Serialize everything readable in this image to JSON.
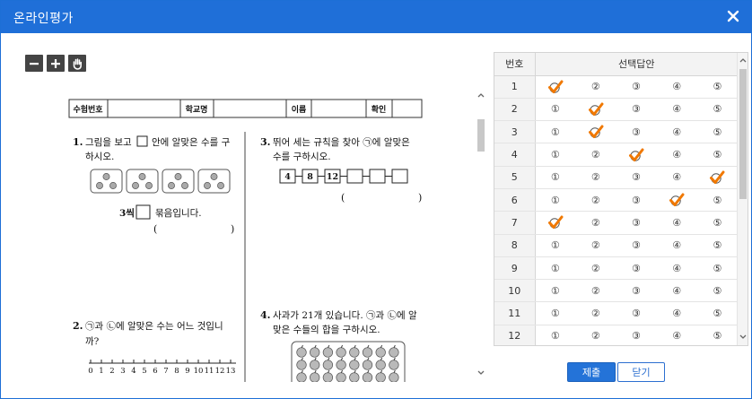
{
  "window": {
    "title": "온라인평가"
  },
  "toolbar": {
    "zoom_out": "minus-icon",
    "zoom_in": "plus-icon",
    "pan": "hand-icon"
  },
  "exam_header": {
    "exam_no_label": "수험번호",
    "school_label": "학교명",
    "name_label": "이름",
    "confirm_label": "확인"
  },
  "questions": {
    "q1": {
      "num": "1.",
      "line1": "그림을 보고",
      "line1b": "안에 알맞은 수를 구",
      "line2": "하시오.",
      "answer_a": "3씩",
      "answer_b": "묶음입니다.",
      "paren_open": "(",
      "paren_close": ")"
    },
    "q2": {
      "num": "2.",
      "line1": "㉠과 ㉡에 알맞은 수는 어느 것입니",
      "line2": "까?",
      "ticks": [
        "0",
        "1",
        "2",
        "3",
        "4",
        "5",
        "6",
        "7",
        "8",
        "9",
        "10",
        "11",
        "12",
        "13"
      ]
    },
    "q3": {
      "num": "3.",
      "line1": "뛰어 세는 규칙을 찾아 ㉠에 알맞은",
      "line2": "수를 구하시오.",
      "boxes": [
        "4",
        "8",
        "12",
        "",
        "",
        ""
      ],
      "paren_open": "(",
      "paren_close": ")"
    },
    "q4": {
      "num": "4.",
      "line1": "사과가 21개 있습니다. ㉠과 ㉡에 알",
      "line2": "맞은 수들의 합을 구하시오."
    }
  },
  "answer_sheet": {
    "col_number": "번호",
    "col_answer": "선택답안",
    "options": [
      "①",
      "②",
      "③",
      "④",
      "⑤"
    ],
    "rows": [
      {
        "no": "1",
        "selected": 1
      },
      {
        "no": "2",
        "selected": 2
      },
      {
        "no": "3",
        "selected": 2
      },
      {
        "no": "4",
        "selected": 3
      },
      {
        "no": "5",
        "selected": 5
      },
      {
        "no": "6",
        "selected": 4
      },
      {
        "no": "7",
        "selected": 1
      },
      {
        "no": "8",
        "selected": 0
      },
      {
        "no": "9",
        "selected": 0
      },
      {
        "no": "10",
        "selected": 0
      },
      {
        "no": "11",
        "selected": 0
      },
      {
        "no": "12",
        "selected": 0
      }
    ]
  },
  "buttons": {
    "submit": "제출",
    "close": "닫기"
  },
  "colors": {
    "titlebar": "#1f6fd8",
    "check": "#f07800",
    "submit": "#2473d8"
  }
}
